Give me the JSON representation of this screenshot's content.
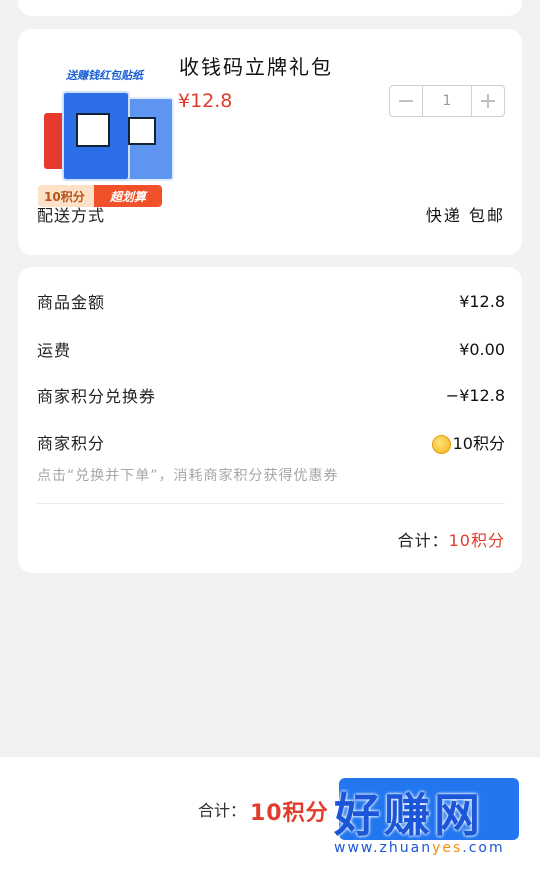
{
  "product": {
    "name": "收钱码立牌礼包",
    "price": "¥12.8",
    "quantity": "1",
    "image": {
      "banner_text": "送赚钱红包贴纸",
      "points_badge": "10积分",
      "tag_badge": "超划算"
    },
    "delivery_label": "配送方式",
    "delivery_value": "快递 包邮"
  },
  "summary": {
    "rows": [
      {
        "label": "商品金额",
        "value": "¥12.8"
      },
      {
        "label": "运费",
        "value": "¥0.00"
      },
      {
        "label": "商家积分兑换券",
        "value": "−¥12.8"
      },
      {
        "label": "商家积分",
        "value": "10积分"
      }
    ],
    "hint": "点击“兑换并下单”，消耗商家积分获得优惠券",
    "total_label": "合计：",
    "total_value": "10积分"
  },
  "bottom_bar": {
    "total_label": "合计：",
    "total_value": "10积分"
  },
  "watermark": {
    "main": "好赚网",
    "sub_prefix": "www.zhuan",
    "sub_accent": "yes",
    "sub_suffix": ".com"
  },
  "colors": {
    "accent_red": "#e23c2c",
    "button_blue": "#2277f0"
  }
}
